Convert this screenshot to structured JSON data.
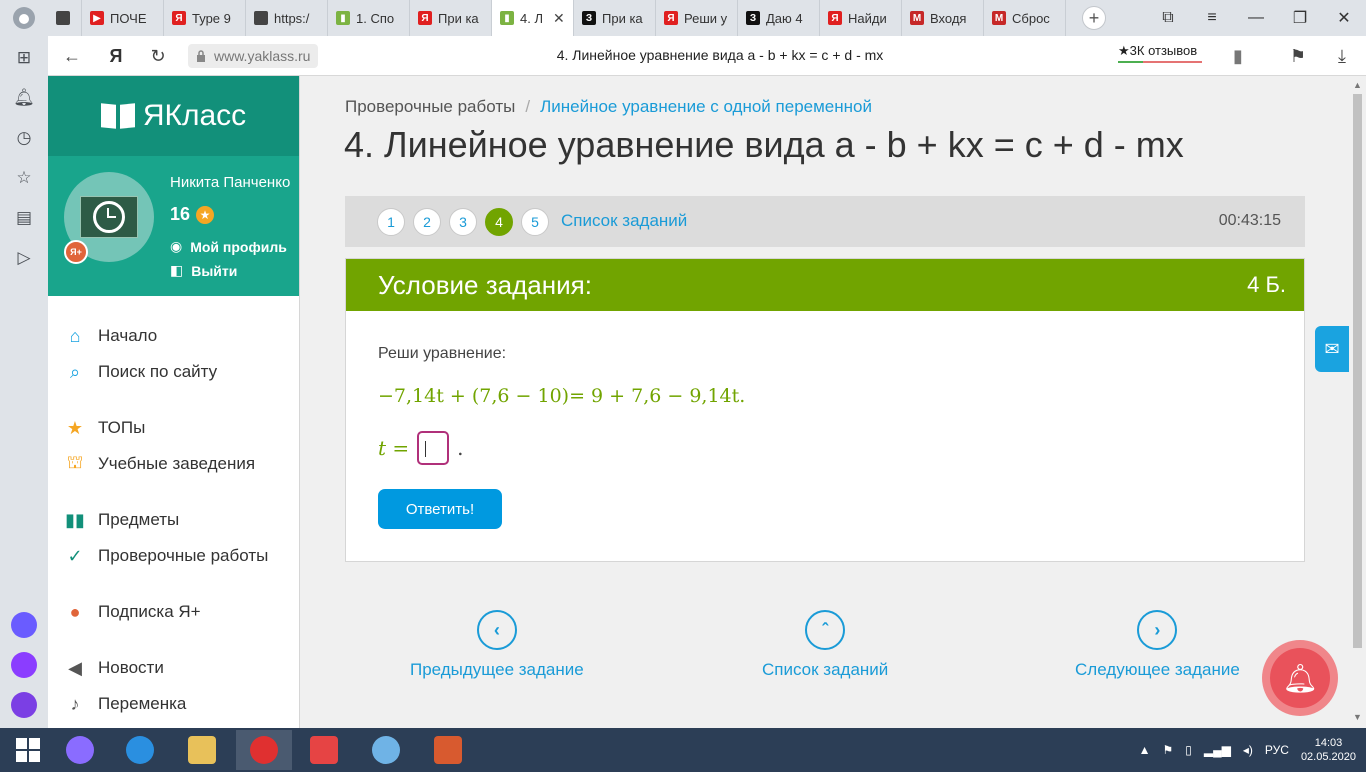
{
  "browser": {
    "tabs": [
      {
        "label": "",
        "color": "#444"
      },
      {
        "label": "ПОЧЕ",
        "color": "#e02020"
      },
      {
        "label": "Туре 9",
        "color": "#e02020"
      },
      {
        "label": "https:/",
        "color": "#444"
      },
      {
        "label": "1. Спо",
        "color": "#7cb342"
      },
      {
        "label": "При ка",
        "color": "#e02020"
      },
      {
        "label": "4. Л",
        "color": "#7cb342",
        "active": true
      },
      {
        "label": "При ка",
        "color": "#111"
      },
      {
        "label": "Реши у",
        "color": "#e02020"
      },
      {
        "label": "Даю 4",
        "color": "#111"
      },
      {
        "label": "Найди",
        "color": "#e02020"
      },
      {
        "label": "Входя",
        "color": "#c62828"
      },
      {
        "label": "Сброс",
        "color": "#c62828"
      }
    ],
    "tab_glyphs": [
      "",
      "▶",
      "Я",
      "",
      "▮",
      "Я",
      "▮",
      "З",
      "Я",
      "З",
      "Я",
      "M",
      "M"
    ],
    "url": "www.yaklass.ru",
    "page_title": "4. Линейное уравнение вида a - b + kx = c + d - mx",
    "reviews": "★3К отзывов"
  },
  "site": {
    "logo": "ЯКласс",
    "user": {
      "name": "Никита Панченко",
      "points": "16",
      "badge": "Я+",
      "profile_link": "Мой профиль",
      "logout_link": "Выйти"
    },
    "nav": [
      {
        "label": "Начало",
        "icon": "home-icon",
        "glyph": "⌂",
        "color": "#1aa3e0"
      },
      {
        "label": "Поиск по сайту",
        "icon": "search-icon",
        "glyph": "⌕",
        "color": "#1aa3e0"
      },
      {
        "gap": true
      },
      {
        "label": "ТОПы",
        "icon": "star-icon",
        "glyph": "★",
        "color": "#f5a623"
      },
      {
        "label": "Учебные заведения",
        "icon": "institution-icon",
        "glyph": "⛫",
        "color": "#f5a623"
      },
      {
        "gap": true
      },
      {
        "label": "Предметы",
        "icon": "book-icon",
        "glyph": "▮▮",
        "color": "#12907a"
      },
      {
        "label": "Проверочные работы",
        "icon": "check-icon",
        "glyph": "✓",
        "color": "#12907a"
      },
      {
        "gap": true
      },
      {
        "label": "Подписка Я+",
        "icon": "subscription-icon",
        "glyph": "●",
        "color": "#e0653a"
      },
      {
        "gap": true
      },
      {
        "label": "Новости",
        "icon": "megaphone-icon",
        "glyph": "◀",
        "color": "#555"
      },
      {
        "label": "Переменка",
        "icon": "bell-icon",
        "glyph": "♪",
        "color": "#555"
      }
    ]
  },
  "main": {
    "breadcrumb_root": "Проверочные работы",
    "breadcrumb_current": "Линейное уравнение с одной переменной",
    "title": "4. Линейное уравнение вида a - b + kx = c + d - mx",
    "task_numbers": [
      "1",
      "2",
      "3",
      "4",
      "5"
    ],
    "active_task": "4",
    "task_list_link": "Список заданий",
    "timer": "00:43:15",
    "card_title": "Условие задания:",
    "card_points": "4 Б.",
    "prompt": "Реши уравнение:",
    "equation": "−7,14t + (7,6 − 10)= 9 + 7,6 − 9,14t.",
    "answer_label": "t =",
    "answer_value": "",
    "submit": "Ответить!",
    "prev_task": "Предыдущее задание",
    "task_list": "Список заданий",
    "next_task": "Следующее задание"
  },
  "taskbar": {
    "lang": "РУС",
    "time": "14:03",
    "date": "02.05.2020"
  },
  "colors": {
    "brand_green": "#71a400",
    "brand_teal": "#12907a",
    "link_blue": "#1a9bd7",
    "submit_blue": "#0099e0"
  }
}
